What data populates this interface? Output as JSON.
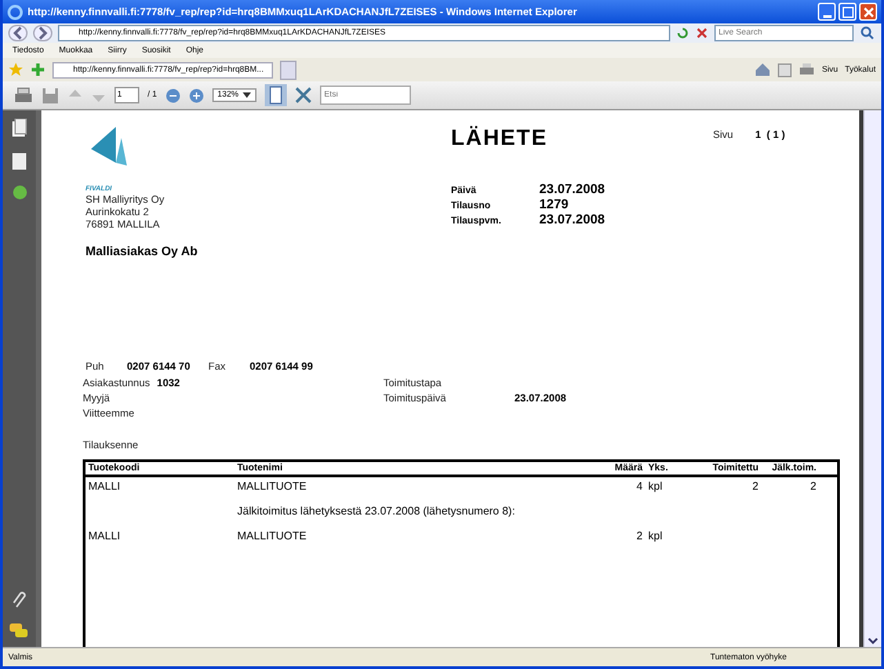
{
  "window": {
    "title": "http://kenny.finnvalli.fi:7778/fv_rep/rep?id=hrq8BMMxuq1LArKDACHANJfL7ZEISES - Windows Internet Explorer"
  },
  "address_bar": {
    "url": "http://kenny.finnvalli.fi:7778/fv_rep/rep?id=hrq8BMMxuq1LArKDACHANJfL7ZEISES",
    "search_placeholder": "Live Search"
  },
  "menu": [
    "Tiedosto",
    "Muokkaa",
    "Siirry",
    "Suosikit",
    "Ohje"
  ],
  "tab": {
    "title": "http://kenny.finnvalli.fi:7778/fv_rep/rep?id=hrq8BM..."
  },
  "command_bar": {
    "page": "Sivu",
    "tools": "Työkalut"
  },
  "pdf_toolbar": {
    "page_value": "1",
    "page_total": "/ 1",
    "zoom": "132%",
    "find_placeholder": "Etsi"
  },
  "document": {
    "logo_text": "FIVALDI",
    "company": [
      "SH Malliyritys Oy",
      "Aurinkokatu 2",
      "76891 MALLILA"
    ],
    "customer": "Malliasiakas Oy Ab",
    "title": "LÄHETE",
    "page_label": "Sivu",
    "page_value": "1  ( 1 )",
    "header_fields": [
      {
        "label": "Päivä",
        "value": "23.07.2008"
      },
      {
        "label": "Tilausno",
        "value": "1279"
      },
      {
        "label": "Tilauspvm.",
        "value": "23.07.2008"
      }
    ],
    "phone_label": "Puh",
    "phone": "0207 6144 70",
    "fax_label": "Fax",
    "fax": "0207 6144 99",
    "left_fields": [
      {
        "label": "Asiakastunnus",
        "value": "1032"
      },
      {
        "label": "Myyjä"
      },
      {
        "label": "Viitteemme"
      }
    ],
    "right_fields": [
      {
        "label": "Toimitustapa"
      },
      {
        "label": "Toimituspäivä",
        "value": "23.07.2008"
      }
    ],
    "order_label": "Tilauksenne",
    "table": {
      "columns": [
        "Tuotekoodi",
        "Tuotenimi",
        "Määrä",
        "Yks.",
        "Toimitettu",
        "Jälk.toim."
      ],
      "rows": [
        {
          "kind": "item",
          "cells": [
            "MALLI",
            "MALLITUOTE",
            "4",
            "kpl",
            "2",
            "2"
          ]
        },
        {
          "kind": "note",
          "text": "Jälkitoimitus lähetyksestä 23.07.2008 (lähetysnumero 8):"
        },
        {
          "kind": "item",
          "cells": [
            "MALLI",
            "MALLITUOTE",
            "2",
            "kpl",
            null,
            null
          ]
        }
      ]
    }
  },
  "status_bar": {
    "left": "Valmis",
    "zone": "Tuntematon vyöhyke"
  }
}
